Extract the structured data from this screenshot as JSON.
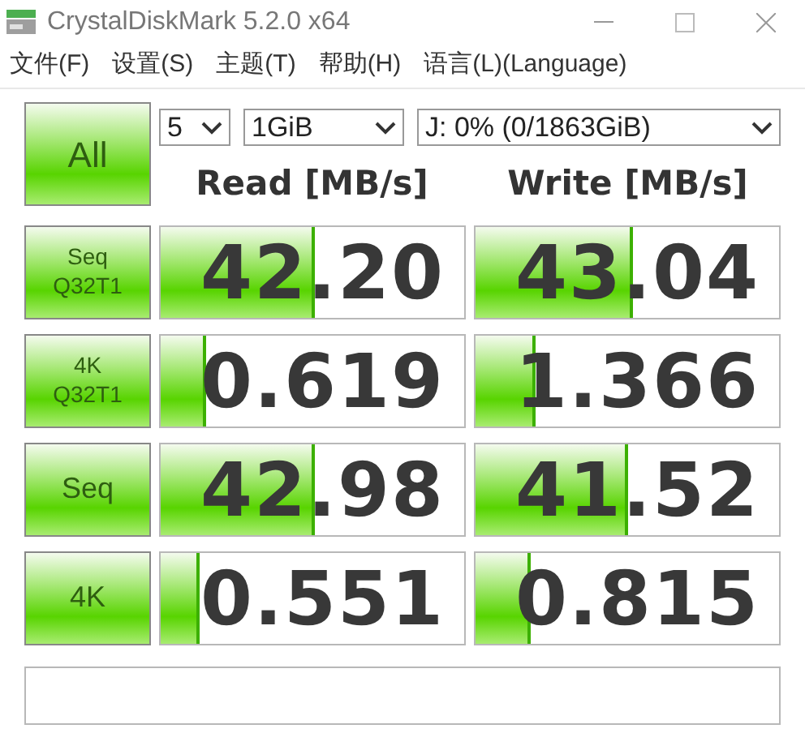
{
  "window": {
    "title": "CrystalDiskMark 5.2.0 x64"
  },
  "menu": [
    "文件(F)",
    "设置(S)",
    "主题(T)",
    "帮助(H)",
    "语言(L)(Language)"
  ],
  "all_button": "All",
  "selects": [
    {
      "value": "5"
    },
    {
      "value": "1GiB"
    },
    {
      "value": "J: 0% (0/1863GiB)"
    }
  ],
  "headers": [
    "Read [MB/s]",
    "Write [MB/s]"
  ],
  "tests": [
    {
      "label": [
        "Seq",
        "Q32T1"
      ],
      "read": {
        "value": "42.20",
        "level": 0.51
      },
      "write": {
        "value": "43.04",
        "level": 0.52
      }
    },
    {
      "label": [
        "4K",
        "Q32T1"
      ],
      "read": {
        "value": "0.619",
        "level": 0.15
      },
      "write": {
        "value": "1.366",
        "level": 0.2
      }
    },
    {
      "label": [
        "Seq"
      ],
      "read": {
        "value": "42.98",
        "level": 0.51
      },
      "write": {
        "value": "41.52",
        "level": 0.5
      }
    },
    {
      "label": [
        "4K"
      ],
      "read": {
        "value": "0.551",
        "level": 0.13
      },
      "write": {
        "value": "0.815",
        "level": 0.18
      }
    }
  ]
}
